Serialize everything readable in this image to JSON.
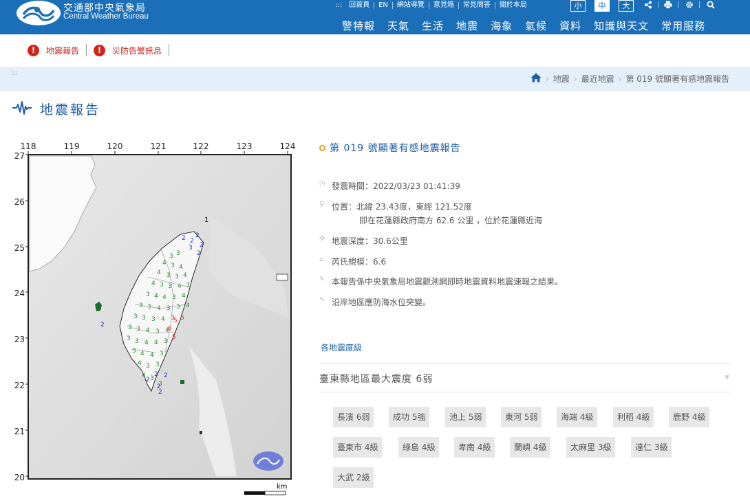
{
  "header": {
    "title_zh": "交通部中央氣象局",
    "title_en": "Central Weather Bureau",
    "top_links": [
      "回首頁",
      "EN",
      "網站導覽",
      "意見箱",
      "常見問答",
      "關於本局"
    ],
    "font_sizes": [
      "小",
      "中",
      "大"
    ],
    "active_font_size": "中",
    "nav": [
      "警特報",
      "天氣",
      "生活",
      "地震",
      "海象",
      "氣候",
      "資料",
      "知識與天文",
      "常用服務"
    ],
    "tool_icons": [
      "share-icon",
      "print-icon",
      "settings-icon",
      "search-icon"
    ]
  },
  "alerts": [
    {
      "icon": "!",
      "label": "地震報告"
    },
    {
      "icon": "!",
      "label": "災防告警訊息"
    }
  ],
  "breadcrumb": {
    "dots": ":::",
    "items": [
      "地震",
      "最近地震",
      "第 019 號顯著有感地震報告"
    ]
  },
  "page_title": "地震報告",
  "map": {
    "lon_labels": [
      "118",
      "119",
      "120",
      "121",
      "122",
      "123",
      "124"
    ],
    "lat_labels": [
      "27",
      "26",
      "25",
      "24",
      "23",
      "22",
      "21",
      "20"
    ],
    "scale_unit": "km",
    "marker_1": "1",
    "intensities_green": [
      "3",
      "3",
      "4",
      "3",
      "4",
      "4",
      "3",
      "3",
      "4",
      "4",
      "3",
      "3",
      "4",
      "3",
      "3",
      "4",
      "4",
      "3",
      "4",
      "3",
      "3",
      "4",
      "3",
      "3",
      "4",
      "3",
      "3",
      "3",
      "4",
      "3",
      "3",
      "3",
      "4",
      "3",
      "4",
      "3",
      "3",
      "4",
      "4",
      "3",
      "3",
      "4",
      "4",
      "3",
      "4",
      "3",
      "3",
      "4",
      "3",
      "3"
    ],
    "intensities_blue": [
      "2",
      "2",
      "2",
      "2",
      "3",
      "2",
      "2",
      "2",
      "2",
      "2",
      "2",
      "2"
    ],
    "intensities_red": [
      "5",
      "5",
      "6",
      "5"
    ]
  },
  "report": {
    "title": "第 019 號顯著有感地震報告",
    "time": "發震時間：2022/03/23 01:41:39",
    "location": "位置：北緯 23.43度，東經 121.52度",
    "location_detail": "即在花蓮縣政府南方 62.6 公里 ，位於花蓮縣近海",
    "depth": "地震深度：30.6公里",
    "magnitude": "芮氏規模：6.6",
    "note1": "本報告係中央氣象局地震觀測網即時地震資料地震速報之結果。",
    "note2": "沿岸地區應防海水位突變。",
    "levels_link": "各地震度級",
    "max_intensity": "臺東縣地區最大震度 6弱",
    "tags": [
      "長濱 6弱",
      "成功 5強",
      "池上 5弱",
      "東河 5弱",
      "海端 4級",
      "利稻 4級",
      "鹿野 4級",
      "臺東市 4級",
      "綠島 4級",
      "卑南 4級",
      "蘭嶼 4級",
      "太麻里 3級",
      "達仁 3級",
      "大武 2級"
    ]
  },
  "colors": {
    "header_bg": "#1a6fb8",
    "accent": "#1f5fa8",
    "alert": "#d42418",
    "intensity_green": "#2e8b2e",
    "intensity_blue": "#2233cc",
    "intensity_red": "#e02020"
  }
}
